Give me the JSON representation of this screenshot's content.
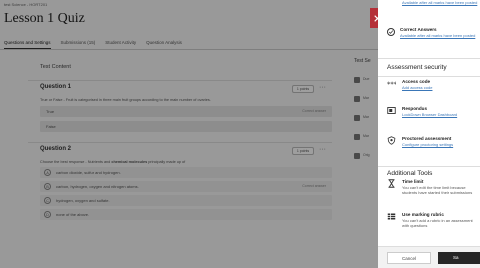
{
  "breadcrumb": "test Science - HORT201",
  "page_title": "Lesson 1 Quiz",
  "tabs": [
    {
      "label": "Questions and Settings"
    },
    {
      "label": "Submissions (15)"
    },
    {
      "label": "Student Activity"
    },
    {
      "label": "Question Analysis"
    }
  ],
  "content": {
    "heading": "Test Content",
    "q1": {
      "title": "Question 1",
      "points": "1 points",
      "text": "True or False - Fruit is categorised in three main fruit groups according to the main number of ovaries.",
      "answers": [
        {
          "label": "True",
          "tag": "Correct answer"
        },
        {
          "label": "False",
          "tag": ""
        }
      ]
    },
    "q2": {
      "title": "Question 2",
      "points": "1 points",
      "text_pre": "Choose the best response - Nutrients and ",
      "text_bold": "chemical molecules",
      "text_post": " principally made up of",
      "choices": [
        {
          "letter": "A",
          "label": "carbon dioxide, sulfur and hydrogen.",
          "tag": ""
        },
        {
          "letter": "B",
          "label": "carbon, hydrogen, oxygen and nitrogen atoms.",
          "tag": "Correct answer"
        },
        {
          "letter": "C",
          "label": "hydrogen, oxygen and sulfate.",
          "tag": ""
        },
        {
          "letter": "D",
          "label": "none of the above.",
          "tag": ""
        }
      ]
    }
  },
  "peek": {
    "title": "Test Se",
    "items": [
      "Due",
      "Mar",
      "Mar",
      "Mar",
      "Orig"
    ]
  },
  "panel": {
    "top_link": "Available after all marks have been posted",
    "correct_answers": {
      "title": "Correct Answers",
      "link": "Available after all marks have been posted"
    },
    "security_heading": "Assessment security",
    "access_code": {
      "title": "Access code",
      "link": "Add access code"
    },
    "respondus": {
      "title": "Respondus",
      "link": "LockDown Browser Dashboard"
    },
    "proctored": {
      "title": "Proctored assessment",
      "link": "Configure proctoring settings"
    },
    "additional_tools_heading": "Additional Tools",
    "time_limit": {
      "title": "Time limit",
      "desc": "You can't edit the time limit because students have started their submissions"
    },
    "marking_rubric": {
      "title": "Use marking rubric",
      "desc": "You can't add a rubric in an assessment with questions"
    },
    "cancel_label": "Cancel",
    "save_label": "Sa"
  },
  "colors": {
    "close_button": "#b53038",
    "link": "#3a76b7",
    "save_button": "#262626"
  }
}
